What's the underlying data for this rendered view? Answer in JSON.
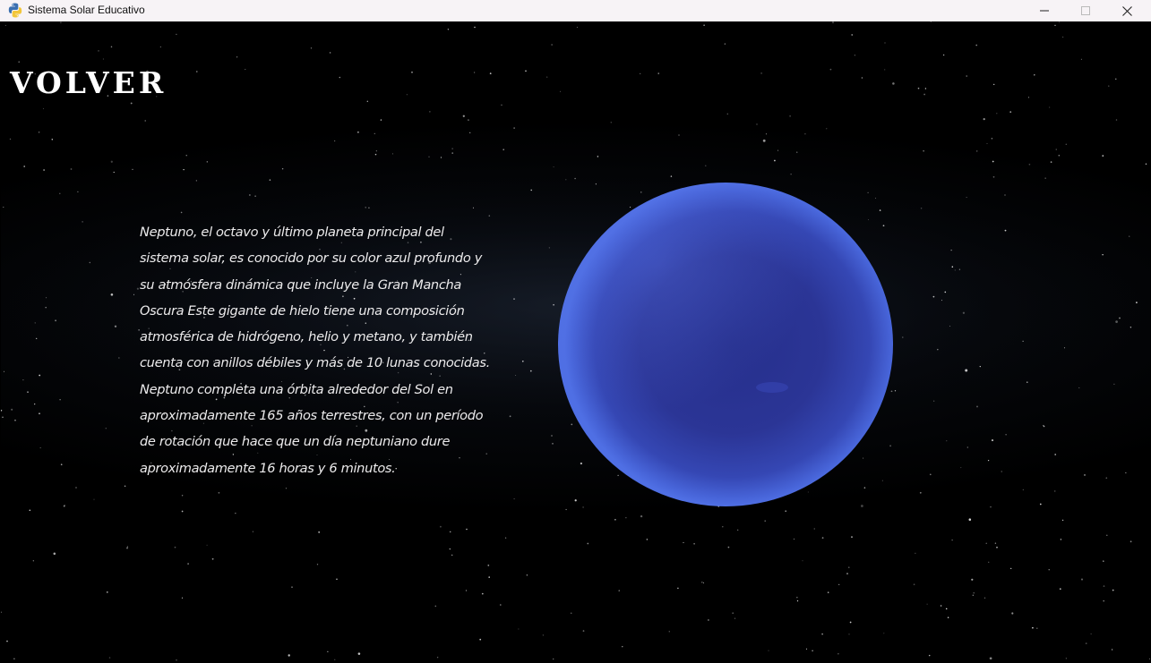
{
  "window": {
    "title": "Sistema Solar Educativo",
    "app_icon": "python-icon",
    "controls": {
      "minimize_icon": "minimize-icon",
      "maximize_icon": "maximize-icon",
      "close_icon": "close-icon"
    }
  },
  "main": {
    "back_label": "VOLVER",
    "planet_icon": "neptune-planet",
    "description": "Neptuno, el octavo y último planeta principal del sistema solar, es conocido por su color azul profundo y su atmósfera dinámica que incluye la Gran Mancha Oscura Este gigante de hielo tiene una composición atmosférica de hidrógeno, helio y metano, y también cuenta con anillos débiles y más de 10 lunas conocidas. Neptuno completa una órbita alrededor del Sol en aproximadamente 165 años terrestres, con un período de rotación que hace que un día neptuniano dure aproximadamente 16 horas y 6 minutos."
  },
  "colors": {
    "background": "#000000",
    "planet_light": "#4a6ae0",
    "planet_dark": "#232e8a",
    "text": "#ecebec",
    "titlebar": "#f7f3f6"
  }
}
